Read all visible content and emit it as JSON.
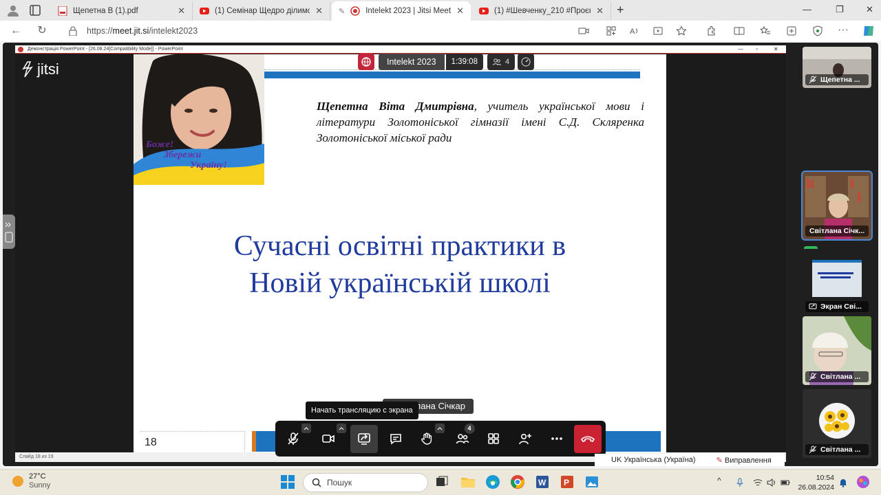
{
  "browser": {
    "tabs": [
      {
        "title": "Щепетна В (1).pdf",
        "icon": "pdf-icon"
      },
      {
        "title": "(1) Семінар Щедро ділимось до",
        "icon": "youtube-icon"
      },
      {
        "title": "Intelekt 2023 | Jitsi Meet",
        "icon": "record-icon",
        "active": true
      },
      {
        "title": "(1) #Шевченку_210 #Проєкт_9_",
        "icon": "youtube-icon"
      }
    ],
    "url_prefix": "https://",
    "url_host": "meet.jit.si",
    "url_path": "/intelekt2023"
  },
  "ppt": {
    "window_title": "Демонстрація PowerPoint - [26.08.24[Compatibility Mode]] - PowerPoint",
    "status": "Слайд 18 из 19"
  },
  "slide": {
    "author_name": "Щепетна Віта Дмитрівна",
    "author_desc": ", учитель української мови і літератури Золотоніської гімназії імені С.Д. Скляренка Золотоніської міської ради",
    "photo_caption_1": "Боже!",
    "photo_caption_2": "Збережи",
    "photo_caption_3": "Україну!",
    "title_line1": "Сучасні освітні практики в",
    "title_line2": "Новій українській школі",
    "number": "18"
  },
  "jitsi": {
    "logo": "jitsi",
    "room_name": "Intelekt 2023",
    "timer": "1:39:08",
    "participant_count": "4",
    "speaker": "Світлана Січкар",
    "speaker_prefix": "н",
    "tooltip": "Начать трансляцию с экрана",
    "participants_badge": "4",
    "filmstrip": [
      {
        "name": "Щепетна ..."
      },
      {
        "name": "Світлана Січк..."
      },
      {
        "name": "Экран Сві..."
      },
      {
        "name": "Світлана ..."
      },
      {
        "name": "Світлана ..."
      }
    ]
  },
  "language_bar": {
    "lang": "UK Українська (Україна)",
    "fix": "Виправлення"
  },
  "taskbar": {
    "temp": "27°C",
    "weather": "Sunny",
    "search_placeholder": "Пошук",
    "time": "10:54",
    "date": "26.08.2024"
  },
  "colors": {
    "accent_blue": "#1e73be",
    "title_blue": "#1f3b9e",
    "hangup": "#cb2233",
    "record": "#c2263a"
  }
}
